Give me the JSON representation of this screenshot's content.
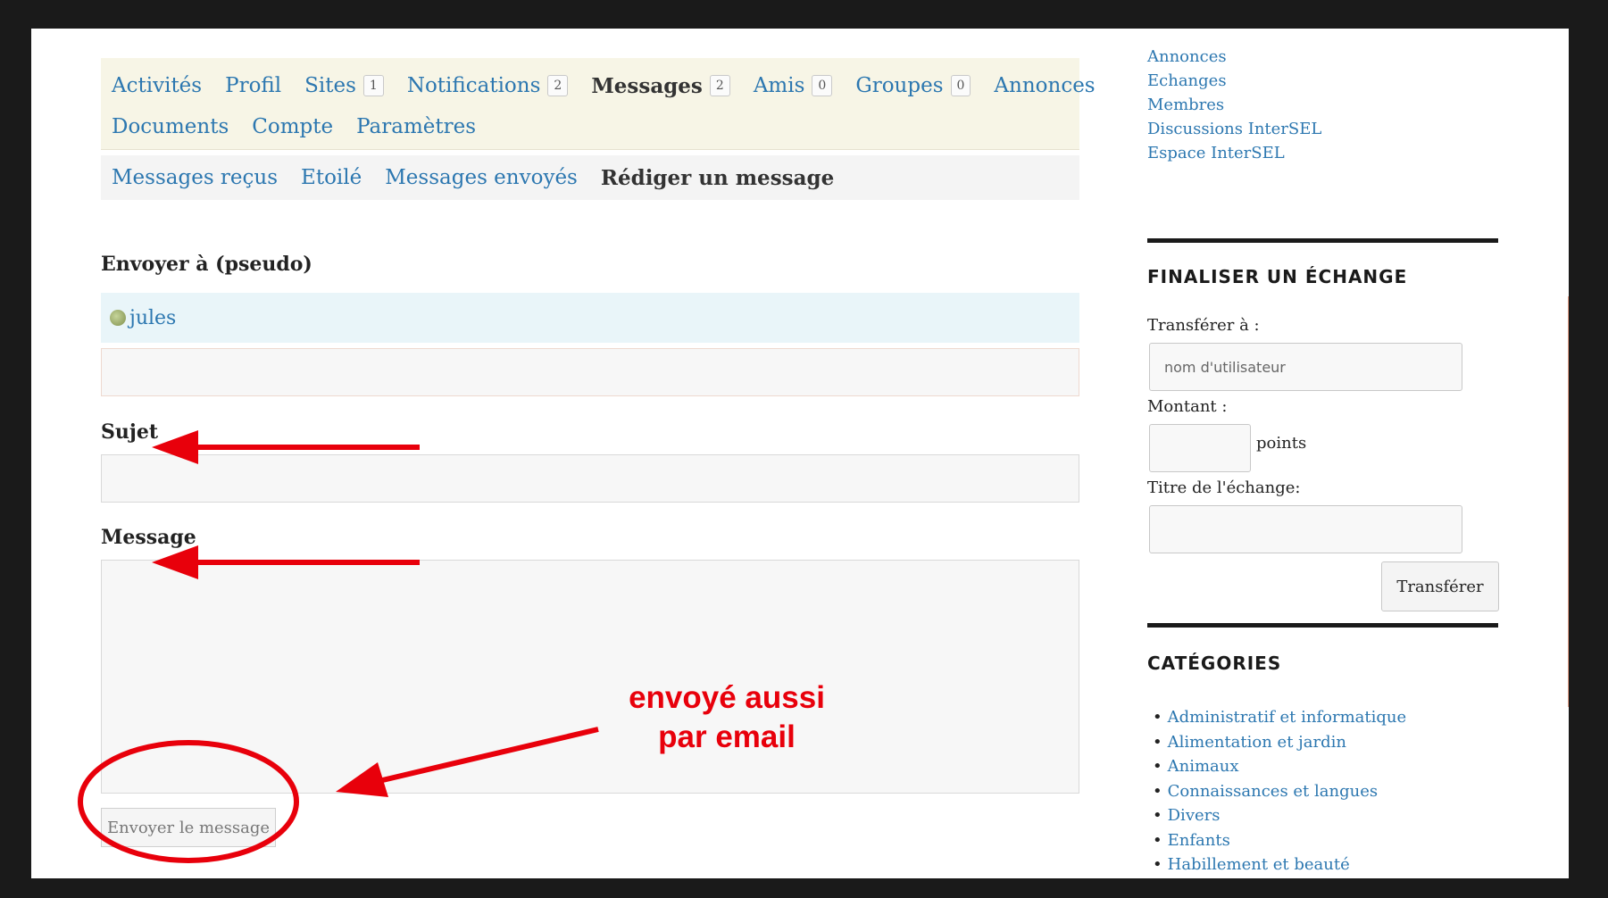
{
  "nav": {
    "items": [
      {
        "label": "Activités"
      },
      {
        "label": "Profil"
      },
      {
        "label": "Sites",
        "count": "1"
      },
      {
        "label": "Notifications",
        "count": "2"
      },
      {
        "label": "Messages",
        "count": "2"
      },
      {
        "label": "Amis",
        "count": "0"
      },
      {
        "label": "Groupes",
        "count": "0"
      },
      {
        "label": "Annonces"
      },
      {
        "label": "Documents"
      },
      {
        "label": "Compte"
      },
      {
        "label": "Paramètres"
      }
    ]
  },
  "subnav": {
    "items": [
      "Messages reçus",
      "Etoilé",
      "Messages envoyés",
      "Rédiger un message"
    ]
  },
  "form": {
    "to_label": "Envoyer à (pseudo)",
    "recipient": "jules",
    "subject_label": "Sujet",
    "message_label": "Message",
    "send_label": "Envoyer le message"
  },
  "sidebar": {
    "links": [
      "Annonces",
      "Echanges",
      "Membres",
      "Discussions InterSEL",
      "Espace InterSEL"
    ],
    "exchange": {
      "title": "FINALISER UN ÉCHANGE",
      "transfer_to_label": "Transférer à :",
      "username_placeholder": "nom d'utilisateur",
      "amount_label": "Montant :",
      "points_label": "points",
      "exchange_title_label": "Titre de l'échange:",
      "transfer_button": "Transférer"
    },
    "categories": {
      "title": "CATÉGORIES",
      "items": [
        "Administratif et informatique",
        "Alimentation et jardin",
        "Animaux",
        "Connaissances et langues",
        "Divers",
        "Enfants",
        "Habillement et beauté"
      ]
    }
  },
  "annotation": {
    "line1": "envoyé aussi",
    "line2": "par email",
    "color": "#e8000b"
  }
}
